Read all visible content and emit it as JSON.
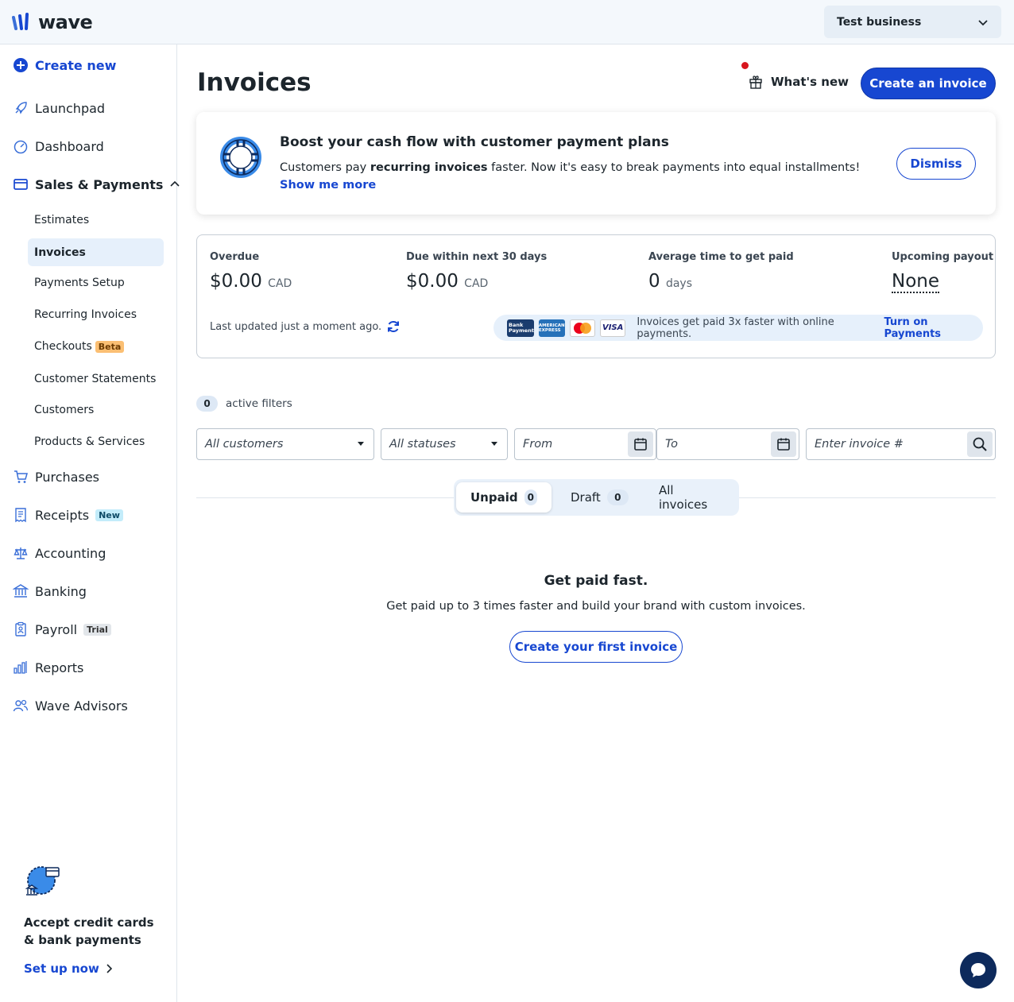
{
  "topbar": {
    "brand": "wave",
    "business": "Test business"
  },
  "sidebar": {
    "create_new": "Create new",
    "items": [
      {
        "label": "Launchpad",
        "icon": "rocket-icon"
      },
      {
        "label": "Dashboard",
        "icon": "gauge-icon"
      },
      {
        "label": "Sales & Payments",
        "icon": "card-icon"
      },
      {
        "label": "Purchases",
        "icon": "cart-icon"
      },
      {
        "label": "Receipts",
        "icon": "receipt-icon",
        "badge": "New"
      },
      {
        "label": "Accounting",
        "icon": "scale-icon"
      },
      {
        "label": "Banking",
        "icon": "bank-icon"
      },
      {
        "label": "Payroll",
        "icon": "clipboard-icon",
        "badge": "Trial"
      },
      {
        "label": "Reports",
        "icon": "bar-chart-icon"
      },
      {
        "label": "Wave Advisors",
        "icon": "people-icon"
      }
    ],
    "sub_items": [
      {
        "label": "Estimates"
      },
      {
        "label": "Invoices",
        "active": true
      },
      {
        "label": "Payments Setup"
      },
      {
        "label": "Recurring Invoices"
      },
      {
        "label": "Checkouts",
        "badge": "Beta"
      },
      {
        "label": "Customer Statements"
      },
      {
        "label": "Customers"
      },
      {
        "label": "Products & Services"
      }
    ],
    "promo": {
      "title": "Accept credit cards & bank payments",
      "link": "Set up now"
    }
  },
  "header": {
    "title": "Invoices",
    "whats_new": "What's new",
    "create_invoice": "Create an invoice"
  },
  "banner": {
    "title": "Boost your cash flow with customer payment plans",
    "body_pre": "Customers pay ",
    "body_bold": "recurring invoices",
    "body_post": " faster. Now it's easy to break payments into equal installments!",
    "link": "Show me more",
    "dismiss": "Dismiss"
  },
  "stats": {
    "overdue_label": "Overdue",
    "overdue_value": "$0.00",
    "overdue_unit": "CAD",
    "due30_label": "Due within next 30 days",
    "due30_value": "$0.00",
    "due30_unit": "CAD",
    "avg_label": "Average time to get paid",
    "avg_value": "0",
    "avg_unit": "days",
    "payout_label": "Upcoming payout",
    "payout_value": "None",
    "last_updated": "Last updated just a moment ago.",
    "payments_text": "Invoices get paid 3x faster with online payments.",
    "payments_link": "Turn on Payments",
    "card_bank": "Bank Payment",
    "card_amex": "AMERICAN EXPRESS",
    "card_visa": "VISA"
  },
  "filters": {
    "active_count": "0",
    "active_label": "active filters",
    "customers_placeholder": "All customers",
    "statuses_placeholder": "All statuses",
    "from_placeholder": "From",
    "to_placeholder": "To",
    "invoice_placeholder": "Enter invoice #"
  },
  "tabs": [
    {
      "label": "Unpaid",
      "count": "0"
    },
    {
      "label": "Draft",
      "count": "0"
    },
    {
      "label": "All invoices"
    }
  ],
  "empty": {
    "title": "Get paid fast.",
    "subtitle": "Get paid up to 3 times faster and build your brand with custom invoices.",
    "cta": "Create your first invoice"
  },
  "colors": {
    "accent": "#1747d1",
    "sidebar_active": "#e6f0fb",
    "notification": "#d8161e"
  }
}
